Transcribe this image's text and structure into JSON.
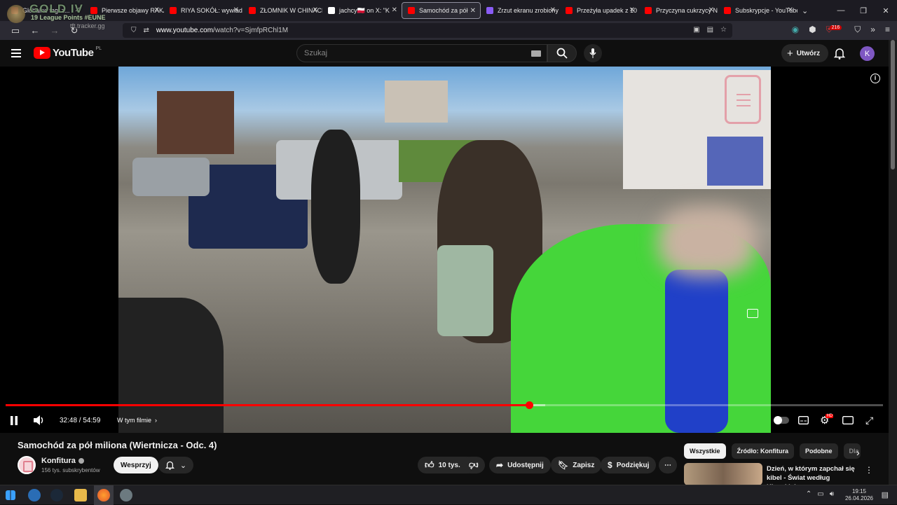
{
  "overlay": {
    "rank": "GOLD IV",
    "league_points": "19 League Points #EUNE",
    "site": "tft.tracker.gg"
  },
  "tabs": [
    {
      "label": "Globalne tagi z...",
      "color": "#c4302b"
    },
    {
      "label": "Pierwsze objawy RAKA",
      "color": "#ff0000"
    },
    {
      "label": "RIYA SOKÓŁ: wywiad",
      "color": "#ff0000"
    },
    {
      "label": "ZŁOMNIK W CHINACH",
      "color": "#ff0000"
    },
    {
      "label": "jachcy🇵🇱 on X: \"K",
      "color": "#ffffff"
    },
    {
      "label": "Samochód za pół",
      "color": "#ff0000",
      "active": true
    },
    {
      "label": "Zrzut ekranu zrobiony",
      "color": "#8a5cf6"
    },
    {
      "label": "Przeżyła upadek z 10",
      "color": "#ff0000"
    },
    {
      "label": "Przyczyna cukrzycy N",
      "color": "#ff0000"
    },
    {
      "label": "Subskrypcje - YouTube",
      "color": "#ff0000"
    }
  ],
  "browser": {
    "url_domain": "www.youtube.com",
    "url_path": "/watch?v=SjmfpRChl1M",
    "badge": "216"
  },
  "yt": {
    "logo": "YouTube",
    "country": "PL",
    "search_placeholder": "Szukaj",
    "create_label": "Utwórz",
    "avatar_letter": "K"
  },
  "player": {
    "current_time": "32:48",
    "duration": "54:59",
    "time_sep": " / ",
    "chapters_label": "W tym filmie",
    "progress": 0.597,
    "buffered": 0.615
  },
  "video": {
    "title": "Samochód za pół miliona (Wiertnicza - Odc. 4)",
    "channel": "Konfitura",
    "subscribers": "156 tys. subskrybentów",
    "support_label": "Wesprzyj",
    "likes": "10 tys.",
    "share": "Udostępnij",
    "save": "Zapisz",
    "thanks": "Podziękuj"
  },
  "chips": [
    "Wszystkie",
    "Źródło: Konfitura",
    "Podobne",
    "Dla"
  ],
  "recommendation": {
    "title": "Dzień, w którym zapchał się kibel - Świat według Kiepskich..."
  },
  "taskbar": {
    "time": "19:15",
    "date": "26.04.2026"
  }
}
